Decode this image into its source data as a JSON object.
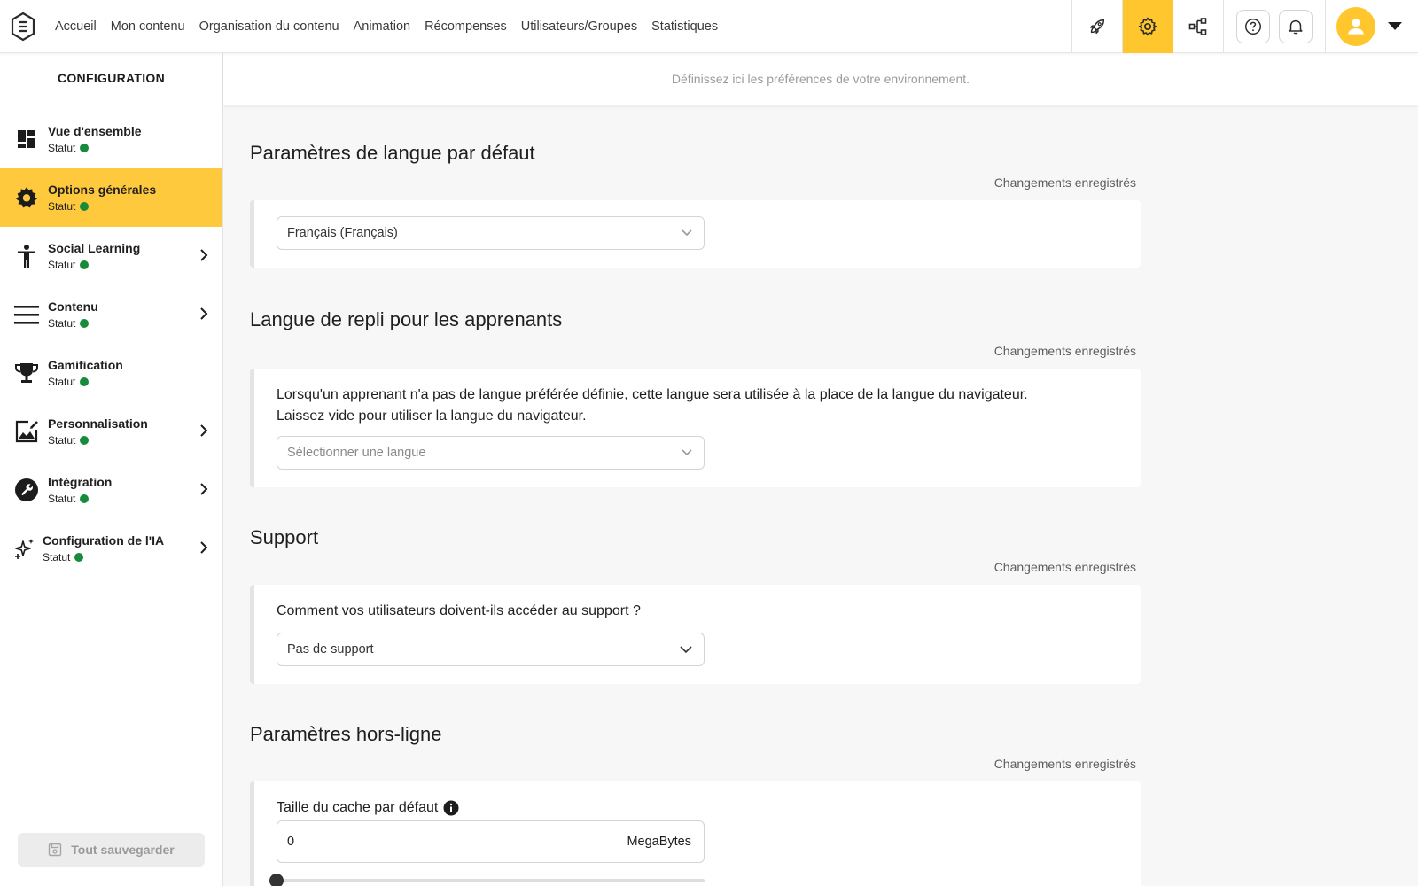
{
  "nav": {
    "items": [
      "Accueil",
      "Mon contenu",
      "Organisation du contenu",
      "Animation",
      "Récompenses",
      "Utilisateurs/Groupes",
      "Statistiques"
    ]
  },
  "topbar": {
    "icons": [
      "rocket-icon",
      "gear-icon",
      "hierarchy-icon",
      "help-icon",
      "bell-icon",
      "user-avatar-icon",
      "caret-down-icon"
    ],
    "active": "gear-icon",
    "accent_color": "#ffc62e"
  },
  "subheader": {
    "text": "Définissez ici les préférences de votre environnement."
  },
  "sidebar": {
    "title": "CONFIGURATION",
    "status_label": "Statut",
    "status_color": "#178a3c",
    "items": [
      {
        "label": "Vue d'ensemble",
        "icon": "dashboard-icon",
        "has_chevron": false,
        "active": false
      },
      {
        "label": "Options générales",
        "icon": "gear-icon",
        "has_chevron": false,
        "active": true
      },
      {
        "label": "Social Learning",
        "icon": "person-icon",
        "has_chevron": true,
        "active": false
      },
      {
        "label": "Contenu",
        "icon": "menu-lines-icon",
        "has_chevron": true,
        "active": false
      },
      {
        "label": "Gamification",
        "icon": "trophy-icon",
        "has_chevron": false,
        "active": false
      },
      {
        "label": "Personnalisation",
        "icon": "image-edit-icon",
        "has_chevron": true,
        "active": false
      },
      {
        "label": "Intégration",
        "icon": "wrench-icon",
        "has_chevron": true,
        "active": false
      },
      {
        "label": "Configuration de l'IA",
        "icon": "sparkle-icon",
        "has_chevron": true,
        "active": false
      }
    ],
    "save_all_label": "Tout sauvegarder"
  },
  "sections": {
    "default_language": {
      "title": "Paramètres de langue par défaut",
      "saved": "Changements enregistrés",
      "select_value": "Français (Français)"
    },
    "fallback_language": {
      "title": "Langue de repli pour les apprenants",
      "saved": "Changements enregistrés",
      "description_line1": "Lorsqu'un apprenant n'a pas de langue préférée définie, cette langue sera utilisée à la place de la langue du navigateur.",
      "description_line2": "Laissez vide pour utiliser la langue du navigateur.",
      "select_placeholder": "Sélectionner une langue"
    },
    "support": {
      "title": "Support",
      "saved": "Changements enregistrés",
      "question": "Comment vos utilisateurs doivent-ils accéder au support ?",
      "select_value": "Pas de support"
    },
    "offline": {
      "title": "Paramètres hors-ligne",
      "saved": "Changements enregistrés",
      "cache_label": "Taille du cache par défaut",
      "cache_value": "0",
      "cache_unit": "MegaBytes",
      "slider_fraction": 0
    }
  }
}
